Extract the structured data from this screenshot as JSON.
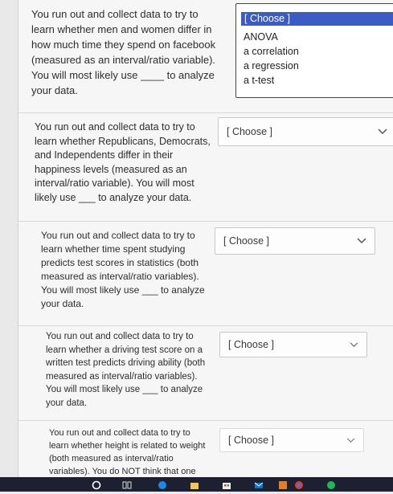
{
  "questions": [
    {
      "text": "You run out and collect data to try to learn whether men and women differ in how much time they spend on facebook (measured as an interval/ratio variable). You will most likely use ____ to analyze your data.",
      "select_label": "[ Choose ]",
      "open": true,
      "options": [
        "[ Choose ]",
        "ANOVA",
        "a correlation",
        "a regression",
        "a t-test"
      ]
    },
    {
      "text": "You run out and collect data to try to learn whether Republicans, Democrats, and Independents differ in their happiness levels (measured as an interval/ratio variable). You will most likely use ___ to analyze your data.",
      "select_label": "[ Choose ]"
    },
    {
      "text": "You run out and collect data to try to learn whether time spent studying predicts test scores in statistics (both measured as interval/ratio variables). You will most likely use ___ to analyze your data.",
      "select_label": "[ Choose ]"
    },
    {
      "text": "You run out and collect data to try to learn whether a driving test score on a written test predicts driving ability (both measured as interval/ratio variables). You will most likely use ___ to analyze your data.",
      "select_label": "[ Choose ]"
    },
    {
      "text": "You run out and collect data to try to learn whether height is related to weight (both measured as interval/ratio variables). You do NOT think that one",
      "select_label": "[ Choose ]"
    }
  ],
  "icons": [
    "start-circle-icon",
    "task-view-icon",
    "edge-browser-icon",
    "file-explorer-icon",
    "store-icon",
    "mail-icon",
    "app-icon",
    "chrome-icon",
    "spotify-icon"
  ]
}
